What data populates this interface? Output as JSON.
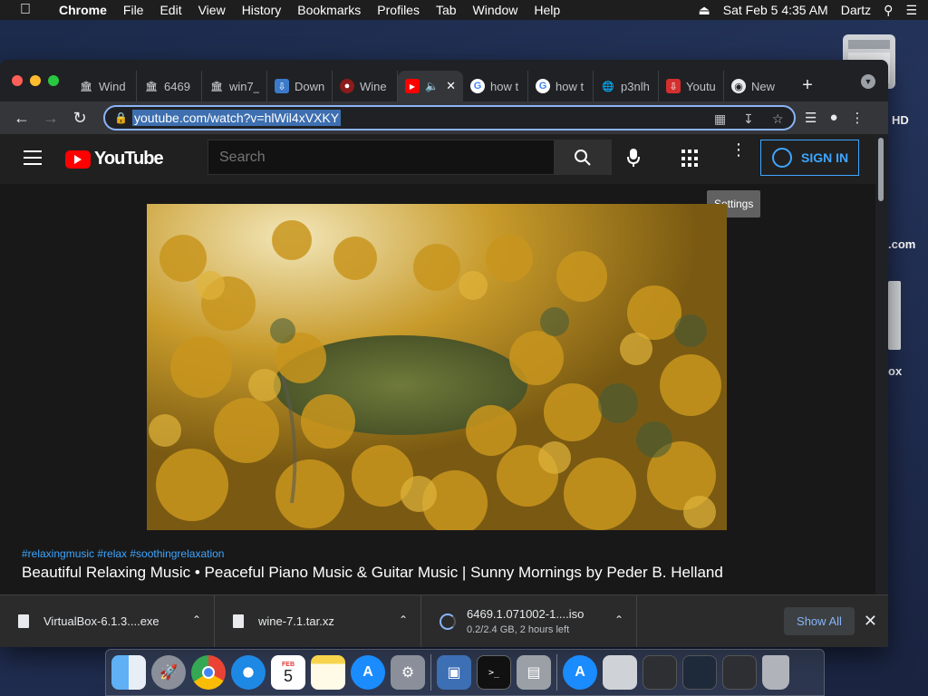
{
  "menubar": {
    "app": "Chrome",
    "items": [
      "File",
      "Edit",
      "View",
      "History",
      "Bookmarks",
      "Profiles",
      "Tab",
      "Window",
      "Help"
    ],
    "datetime": "Sat Feb 5  4:35 AM",
    "user": "Dartz"
  },
  "desktop": {
    "icon1_label": "HD",
    "icon2_label": ".com",
    "icon3_label": "ox"
  },
  "tabs": [
    {
      "title": "Wind",
      "favicon": "museum-icon"
    },
    {
      "title": "6469",
      "favicon": "museum-icon"
    },
    {
      "title": "win7_",
      "favicon": "museum-icon"
    },
    {
      "title": "Down",
      "favicon": "download-page-icon"
    },
    {
      "title": "Wine",
      "favicon": "wine-icon"
    },
    {
      "title": "",
      "favicon": "youtube-icon",
      "active": true
    },
    {
      "title": "how t",
      "favicon": "google-icon"
    },
    {
      "title": "how t",
      "favicon": "google-icon"
    },
    {
      "title": "p3nlh",
      "favicon": "globe-icon"
    },
    {
      "title": "Youtu",
      "favicon": "youtube-download-icon"
    },
    {
      "title": "New",
      "favicon": "chrome-icon"
    }
  ],
  "omnibox": {
    "url": "youtube.com/watch?v=hlWil4xVXKY"
  },
  "youtube": {
    "logo_text": "YouTube",
    "search_placeholder": "Search",
    "sign_in": "SIGN IN",
    "tooltip": "Settings",
    "tags": "#relaxingmusic #relax #soothingrelaxation",
    "title": "Beautiful Relaxing Music • Peaceful Piano Music & Guitar Music | Sunny Mornings by Peder B. Helland"
  },
  "downloads": [
    {
      "name": "VirtualBox-6.1.3....exe",
      "status": ""
    },
    {
      "name": "wine-7.1.tar.xz",
      "status": ""
    },
    {
      "name": "6469.1.071002-1....iso",
      "status": "0.2/2.4 GB, 2 hours left"
    }
  ],
  "shelf": {
    "show_all": "Show All"
  },
  "dock": {
    "calendar_month": "FEB",
    "calendar_day": "5"
  },
  "colors": {
    "youtube_red": "#ff0000",
    "link_blue": "#3ea6ff",
    "chrome_dark": "#202124"
  }
}
